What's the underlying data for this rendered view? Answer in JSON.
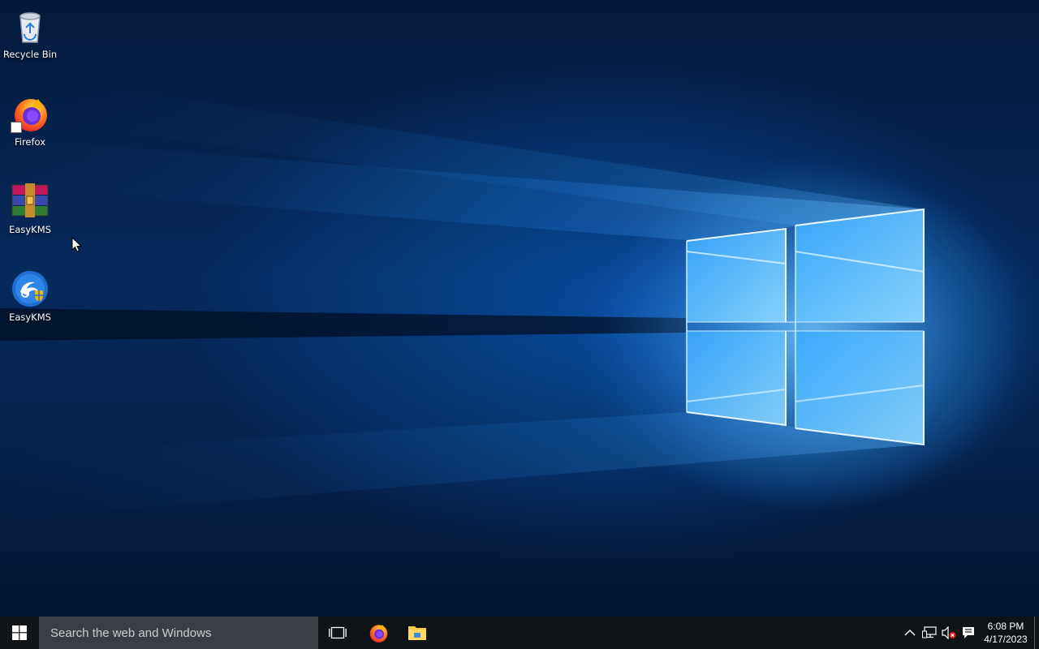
{
  "desktop": {
    "icons": [
      {
        "label": "Recycle Bin",
        "icon": "recycle-bin-icon"
      },
      {
        "label": "Firefox",
        "icon": "firefox-icon"
      },
      {
        "label": "EasyKMS",
        "icon": "winrar-archive-icon"
      },
      {
        "label": "EasyKMS",
        "icon": "easykms-app-icon"
      }
    ]
  },
  "taskbar": {
    "search_placeholder": "Search the web and Windows",
    "pinned": [
      {
        "name": "task-view",
        "icon": "task-view-icon"
      },
      {
        "name": "firefox",
        "icon": "firefox-icon"
      },
      {
        "name": "file-explorer",
        "icon": "folder-icon"
      }
    ],
    "tray": {
      "icons": [
        "chevron-up-icon",
        "network-icon",
        "volume-muted-icon",
        "action-center-icon"
      ],
      "time": "6:08 PM",
      "date": "4/17/2023"
    }
  },
  "colors": {
    "taskbar_bg": "#111417",
    "search_bg": "#3b3f45",
    "wallpaper_accent": "#3aa8ff",
    "start_blue": "#ffffff"
  }
}
